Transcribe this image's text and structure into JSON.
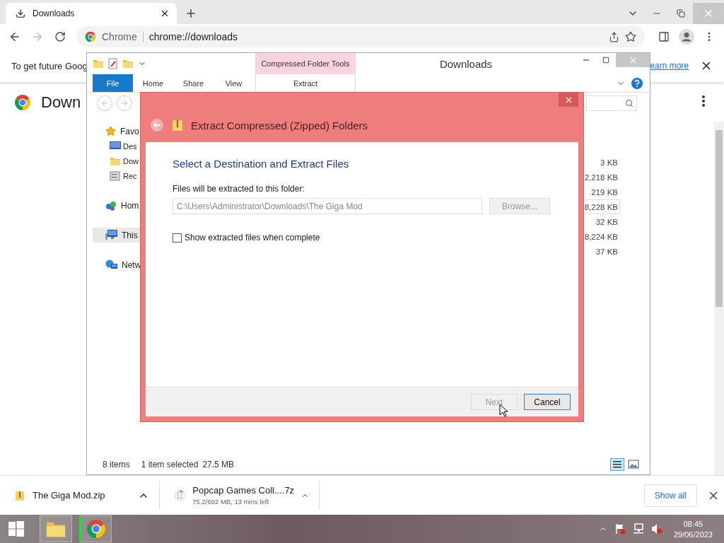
{
  "browser": {
    "tab_title": "Downloads",
    "site": "Chrome",
    "url": "chrome://downloads",
    "infobar_text": "To get future Goog",
    "infobar_link": "earn more",
    "page_heading": "Down"
  },
  "explorer": {
    "title": "Downloads",
    "context_tab": "Compressed Folder Tools",
    "ribbon_tabs": [
      {
        "label": "File",
        "selected": true
      },
      {
        "label": "Home",
        "selected": false
      },
      {
        "label": "Share",
        "selected": false
      },
      {
        "label": "View",
        "selected": false
      },
      {
        "label": "Extract",
        "selected": false
      }
    ],
    "nav": [
      {
        "label": "Favo",
        "kind": "star",
        "selected": false,
        "children": [
          {
            "label": "Des",
            "kind": "desktop",
            "selected": false
          },
          {
            "label": "Dow",
            "kind": "downloads",
            "selected": false
          },
          {
            "label": "Rec",
            "kind": "recent",
            "selected": false
          }
        ]
      },
      {
        "label": "Hom",
        "kind": "homegroup",
        "selected": false
      },
      {
        "label": "This",
        "kind": "pc",
        "selected": true
      },
      {
        "label": "Netw",
        "kind": "network",
        "selected": false
      }
    ],
    "sizes": [
      {
        "text": "3 KB",
        "selected": false
      },
      {
        "text": "2,218 KB",
        "selected": false
      },
      {
        "text": "219 KB",
        "selected": false
      },
      {
        "text": "8,228 KB",
        "selected": true
      },
      {
        "text": "32 KB",
        "selected": false
      },
      {
        "text": "8,224 KB",
        "selected": false
      },
      {
        "text": "37 KB",
        "selected": false
      }
    ],
    "status": {
      "count": "8 items",
      "selection": "1 item selected",
      "size": "27.5 MB"
    }
  },
  "dialog": {
    "title": "Extract Compressed (Zipped) Folders",
    "heading": "Select a Destination and Extract Files",
    "field_label": "Files will be extracted to this folder:",
    "path": "C:\\Users\\Administrator\\Downloads\\The Giga Mod",
    "browse": {
      "label": "Browse...",
      "disabled": true
    },
    "show_files": {
      "label": "Show extracted files when complete",
      "checked": false
    },
    "buttons": [
      {
        "label": "Next",
        "disabled": true
      },
      {
        "label": "Cancel",
        "disabled": false
      }
    ]
  },
  "downloads": [
    {
      "kind": "file",
      "name": "The Giga Mod.zip"
    },
    {
      "kind": "progress",
      "name": "Popcap Games Coll....7z",
      "status": "75.2/692 MB, 13 mins left",
      "level": 0.11
    }
  ],
  "show_all": "Show all",
  "taskbar": {
    "apps": [
      {
        "kind": "explorer"
      },
      {
        "kind": "chrome"
      }
    ],
    "time": "08:45",
    "date": "29/06/2023"
  }
}
